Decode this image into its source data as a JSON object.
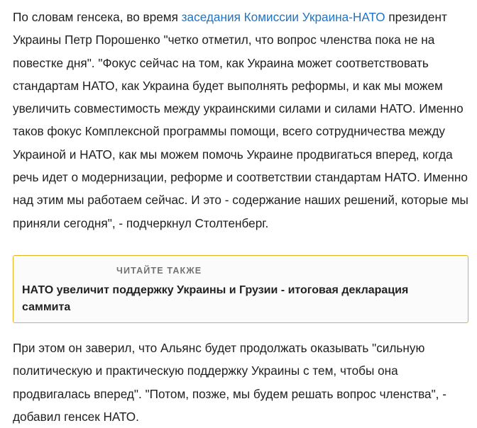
{
  "paragraph_1": {
    "before_link": "По словам генсека, во время ",
    "link_text": "заседания Комиссии Украина-НАТО",
    "after_link": " президент Украины Петр Порошенко \"четко отметил, что вопрос членства пока не на повестке дня\". \"Фокус сейчас на том, как Украина может соответствовать стандартам НАТО, как Украина будет выполнять реформы, и как мы можем увеличить совместимость между украинскими силами и силами НАТО. Именно таков фокус Комплексной программы помощи, всего сотрудничества между Украиной и НАТО, как мы можем помочь Украине продвигаться вперед, когда речь идет о модернизации, реформе и соответствии стандартам НАТО. Именно над этим мы работаем сейчас. И это - содержание наших решений, которые мы приняли сегодня\", - подчеркнул Столтенберг."
  },
  "read_also": {
    "label": "ЧИТАЙТЕ ТАКЖЕ",
    "title": "НАТО увеличит поддержку Украины и Грузии - итоговая декларация саммита",
    "border_color": "#e8b21e"
  },
  "paragraph_2": {
    "text": "При этом он заверил, что Альянс будет продолжать оказывать \"сильную политическую и практическую поддержку Украины с тем, чтобы она продвигалась вперед\". \"Потом, позже, мы будем решать вопрос членства\", - добавил генсек НАТО."
  },
  "colors": {
    "link": "#1f74c6",
    "text": "#1f1f1f"
  }
}
